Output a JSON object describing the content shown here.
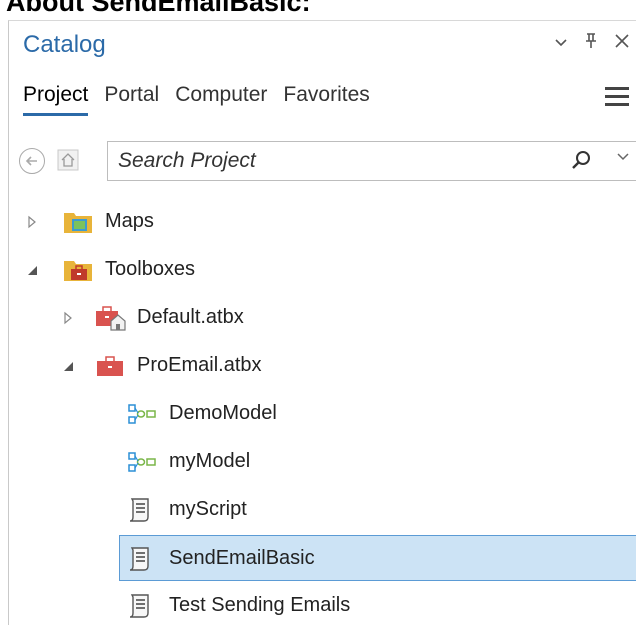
{
  "page": {
    "heading": "About SendEmailBasic:"
  },
  "pane": {
    "title": "Catalog",
    "controls": {
      "options": "⌄",
      "pin": "⫫",
      "close": "✕"
    }
  },
  "tabs": [
    {
      "label": "Project",
      "active": true
    },
    {
      "label": "Portal",
      "active": false
    },
    {
      "label": "Computer",
      "active": false
    },
    {
      "label": "Favorites",
      "active": false
    }
  ],
  "search": {
    "placeholder": "Search Project",
    "value": ""
  },
  "tree": [
    {
      "label": "Maps",
      "icon": "maps-folder-icon",
      "expanded": false
    },
    {
      "label": "Toolboxes",
      "icon": "toolboxes-folder-icon",
      "expanded": true
    },
    {
      "label": "Default.atbx",
      "icon": "default-toolbox-icon",
      "expanded": false
    },
    {
      "label": "ProEmail.atbx",
      "icon": "toolbox-icon",
      "expanded": true
    },
    {
      "label": "DemoModel",
      "icon": "model-icon"
    },
    {
      "label": "myModel",
      "icon": "model-icon"
    },
    {
      "label": "myScript",
      "icon": "script-icon"
    },
    {
      "label": "SendEmailBasic",
      "icon": "script-icon",
      "selected": true
    },
    {
      "label": "Test Sending Emails",
      "icon": "script-icon"
    }
  ],
  "colors": {
    "accent": "#2b6aa8",
    "selection": "#cce3f5",
    "selection_border": "#5b9bd5",
    "toolbox_red": "#c0392b",
    "folder_yellow": "#e8b43a"
  }
}
